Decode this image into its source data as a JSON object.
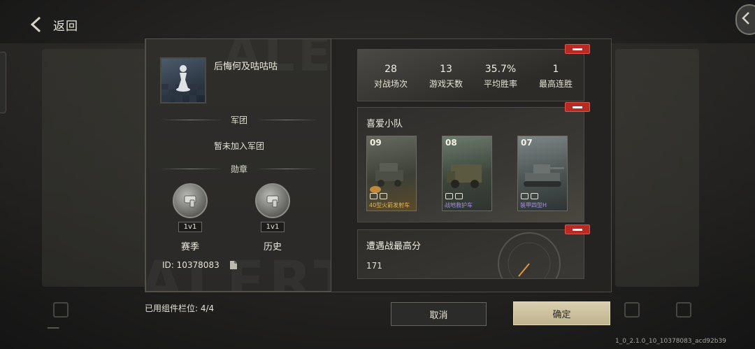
{
  "header": {
    "back_label": "返回"
  },
  "profile": {
    "username": "后悔何及咕咕咕",
    "legion_heading": "军团",
    "legion_status": "暂未加入军团",
    "medals_heading": "勋章",
    "medals": [
      {
        "tag": "1v1",
        "name": "赛季"
      },
      {
        "tag": "1v1",
        "name": "历史"
      }
    ],
    "id_text": "ID: 10378083"
  },
  "stats": [
    {
      "value": "28",
      "label": "对战场次"
    },
    {
      "value": "13",
      "label": "游戏天数"
    },
    {
      "value": "35.7%",
      "label": "平均胜率"
    },
    {
      "value": "1",
      "label": "最高连胜"
    }
  ],
  "squad": {
    "title": "喜爱小队",
    "units": [
      {
        "number": "09",
        "name": "40型火箭发射车",
        "name_color": "#e7b450"
      },
      {
        "number": "08",
        "name": "战地救护车",
        "name_color": "#a98ee8"
      },
      {
        "number": "07",
        "name": "装甲四型H",
        "name_color": "#a98ee8"
      }
    ]
  },
  "encounter": {
    "title": "遭遇战最高分",
    "value": "171"
  },
  "footer": {
    "slots_text": "已用组件栏位:  4/4",
    "cancel_label": "取消",
    "confirm_label": "确定"
  },
  "version": "1_0_2.1.0_10_10378083_acd92b39",
  "icons": [
    "back-arrow-icon",
    "chess-knight-avatar",
    "copy-icon",
    "remove-icon",
    "medal-icon",
    "corner-arrow-icon"
  ]
}
